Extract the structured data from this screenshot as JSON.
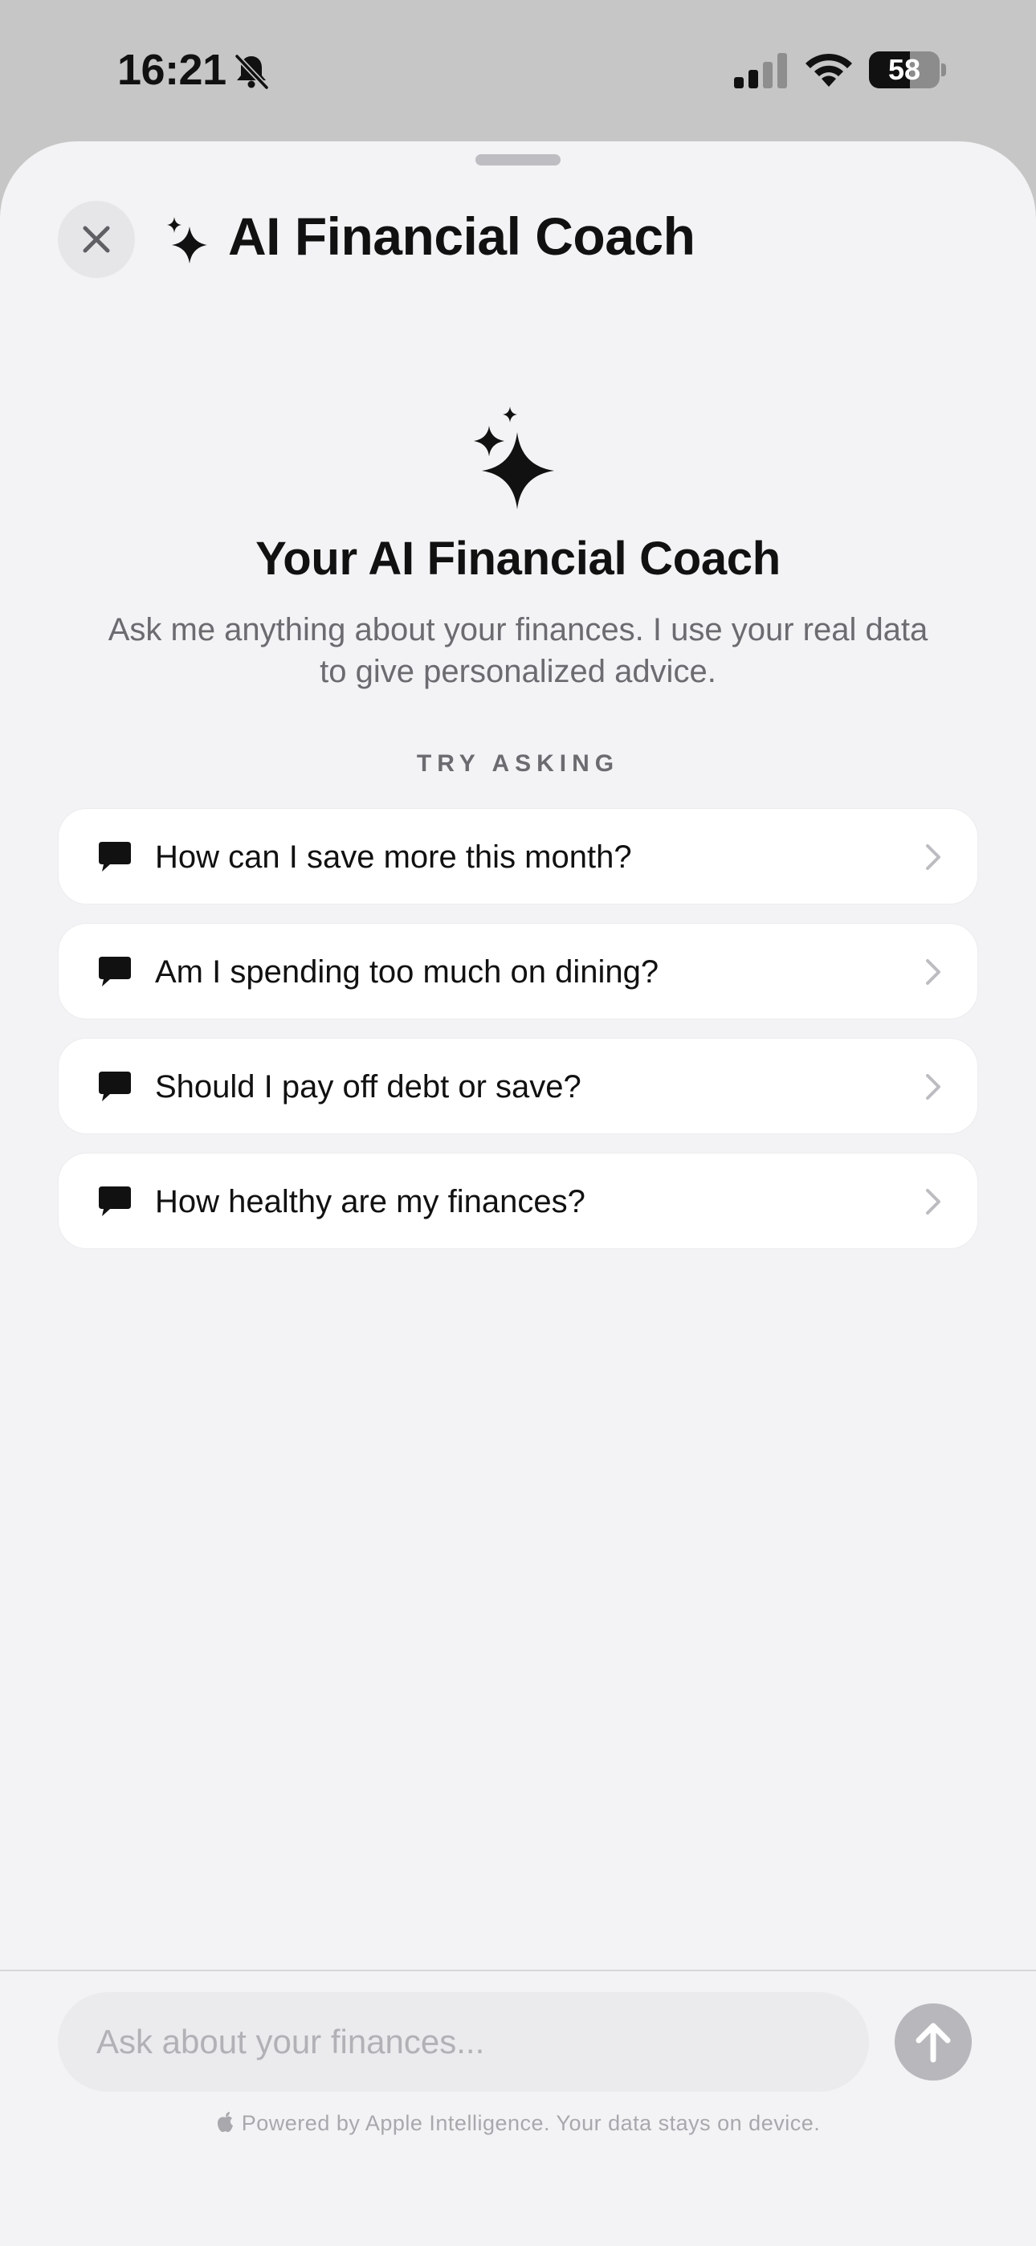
{
  "status_bar": {
    "time": "16:21",
    "battery_level": "58",
    "battery_fraction": 0.58
  },
  "header": {
    "title": "AI Financial Coach",
    "close_icon": "close-icon",
    "sparkle_icon": "sparkles-icon"
  },
  "hero": {
    "icon": "sparkles-icon",
    "title": "Your AI Financial Coach",
    "subtitle": "Ask me anything about your finances. I use your real data to give personalized advice."
  },
  "suggestions": {
    "heading": "TRY ASKING",
    "items": [
      {
        "label": "How can I save more this month?"
      },
      {
        "label": "Am I spending too much on dining?"
      },
      {
        "label": "Should I pay off debt or save?"
      },
      {
        "label": "How healthy are my finances?"
      }
    ]
  },
  "composer": {
    "placeholder": "Ask about your finances...",
    "footer": "Powered by Apple Intelligence. Your data stays on device."
  },
  "colors": {
    "sheet_background": "#f3f3f5",
    "card_background": "#ffffff",
    "text_primary": "#111111",
    "text_secondary": "#6b6b70",
    "send_button": "#b7b7bc"
  }
}
